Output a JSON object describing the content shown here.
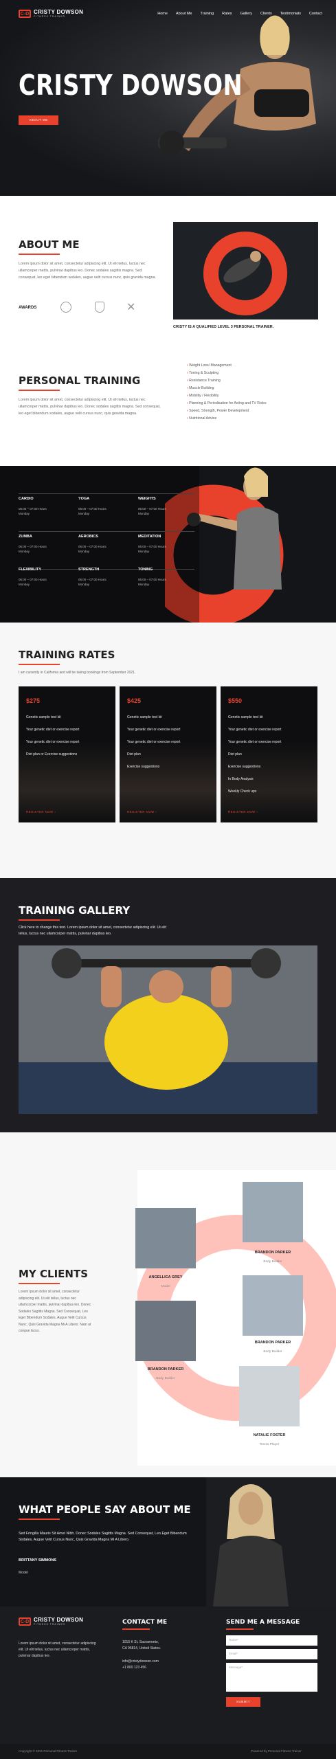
{
  "brand": {
    "name": "CRISTY DOWSON",
    "tagline": "FITNESS TRAINER",
    "mark": "C-D"
  },
  "nav": [
    "Home",
    "About Me",
    "Training",
    "Rates",
    "Gallery",
    "Clients",
    "Testimonials",
    "Contact"
  ],
  "hero": {
    "title": "CRISTY DOWSON",
    "button": "ABOUT ME"
  },
  "about": {
    "title": "ABOUT ME",
    "text": "Lorem ipsum dolor sit amet, consectetur adipiscing elit. Ut elit tellus, luctus nec ullamcorper mattis, pulvinar dapibus leo. Donec sodales sagittis magna. Sed consequat, leo eget bibendum sodales, augue velit cursus nunc, quis gravida magna.",
    "awards": "AWARDS",
    "caption": "CRISTY IS A QUALIFIED LEVEL 3 PERSONAL TRAINER."
  },
  "training": {
    "title": "PERSONAL TRAINING",
    "text": "Lorem ipsum dolor sit amet, consectetur adipiscing elit. Ut elit tellus, luctus nec ullamcorper mattis, pulvinar dapibus leo. Donec sodales sagittis magna. Sed consequat, leo eget bibendum sodales, augue velit cursus nunc, quis gravida magna.",
    "list": [
      "Weight Loss/ Management",
      "Toning & Sculpting",
      "Resistance Training",
      "Muscle Building",
      "Mobility / Flexibility",
      "Planning & Periodisation for Acting and TV Roles",
      "Speed, Strength, Power Development",
      "Nutritional Advice"
    ]
  },
  "schedule": [
    {
      "name": "CARDIO",
      "time": "06:00 – 07:00 Hours",
      "day": "Monday"
    },
    {
      "name": "YOGA",
      "time": "06:00 – 07:00 Hours",
      "day": "Monday"
    },
    {
      "name": "WEIGHTS",
      "time": "06:00 – 07:00 Hours",
      "day": "Monday"
    },
    {
      "name": "ZUMBA",
      "time": "06:00 – 07:00 Hours",
      "day": "Monday"
    },
    {
      "name": "AEROBICS",
      "time": "06:00 – 07:00 Hours",
      "day": "Monday"
    },
    {
      "name": "MEDITATION",
      "time": "06:00 – 07:00 Hours",
      "day": "Monday"
    },
    {
      "name": "FLEXIBILITY",
      "time": "06:00 – 07:00 Hours",
      "day": "Monday"
    },
    {
      "name": "STRENGTH",
      "time": "06:00 – 07:00 Hours",
      "day": "Monday"
    },
    {
      "name": "TONING",
      "time": "06:00 – 07:00 Hours",
      "day": "Monday"
    }
  ],
  "rates": {
    "title": "TRAINING RATES",
    "sub": "I am currently in California and will be taking bookings from September 2021.",
    "cards": [
      {
        "price": "$275",
        "items": [
          "Genetic sample test kit",
          "Your genetic diet or exercise report",
          "Your genetic diet or exercise report",
          "Diet plan or Exercise suggestions"
        ],
        "cta": "REGISTER NOW"
      },
      {
        "price": "$425",
        "items": [
          "Genetic sample test kit",
          "Your genetic diet or exercise report",
          "Your genetic diet or exercise report",
          "Diet plan",
          "Exercise suggestions"
        ],
        "cta": "REGISTER NOW"
      },
      {
        "price": "$550",
        "items": [
          "Genetic sample test kit",
          "Your genetic diet or exercise report",
          "Your genetic diet or exercise report",
          "Diet plan",
          "Exercise suggestions",
          "In Body Analysis",
          "Weekly Check ups"
        ],
        "cta": "REGISTER NOW"
      }
    ]
  },
  "gallery": {
    "title": "TRAINING GALLERY",
    "text": "Click here to change this text. Lorem ipsum dolor sit amet, consectetur adipiscing elit. Ut elit tellus, luctus nec ullamcorper mattis, pulvinar dapibus leo."
  },
  "clients": {
    "title": "MY CLIENTS",
    "text": "Lorem ipsum dolor sit amet, consectetur adipiscing elit. Ut elit tellus, luctus nec ullamcorper mattis, pulvinar dapibus leo. Donec Sodales Sagittis Magna. Sed Consequat, Leo Eget Bibendum Sodales, Augue Velit Cursus Nunc, Quis Gravida Magna Mi A Libero. Nam at congue lacus.",
    "people": [
      {
        "name": "ANGELLICA GREY",
        "role": "Model"
      },
      {
        "name": "BRANDON PARKER",
        "role": "Body Builder"
      },
      {
        "name": "BRANDON PARKER",
        "role": "Body Builder"
      },
      {
        "name": "BRANDON PARKER",
        "role": "Body Builder"
      },
      {
        "name": "NATALIE FOSTER",
        "role": "Tennis Player"
      }
    ]
  },
  "testimonial": {
    "title": "WHAT PEOPLE SAY ABOUT ME",
    "quote": "Sed Fringilla Mauris Sit Amet Nibh. Donec Sodales Sagittis Magna. Sed Consequat, Leo Eget Bibendum Sodales, Augue Velit Cursus Nunc, Quis Gravida Magna Mi A Libero.",
    "author": "BRITTANY SIMMONS",
    "role": "Model"
  },
  "footer": {
    "about": "Lorem ipsum dolor sit amet, consectetur adipiscing elit. Ut elit tellus, luctus nec ullamcorper mattis, pulvinar dapibus leo.",
    "contact_title": "CONTACT ME",
    "address1": "1015 K St, Sacramento,",
    "address2": "CA 95814, United States.",
    "email": "info@cristydowson.com",
    "phone": "+1 800 123 456",
    "form_title": "SEND ME A MESSAGE",
    "name_ph": "Name*",
    "email_ph": "Email*",
    "msg_ph": "Message*",
    "submit": "SUBMIT",
    "copyright": "Copyright © 2021 Personal Fitness Trainer",
    "credit": "Powered by Personal Fitness Trainer"
  }
}
